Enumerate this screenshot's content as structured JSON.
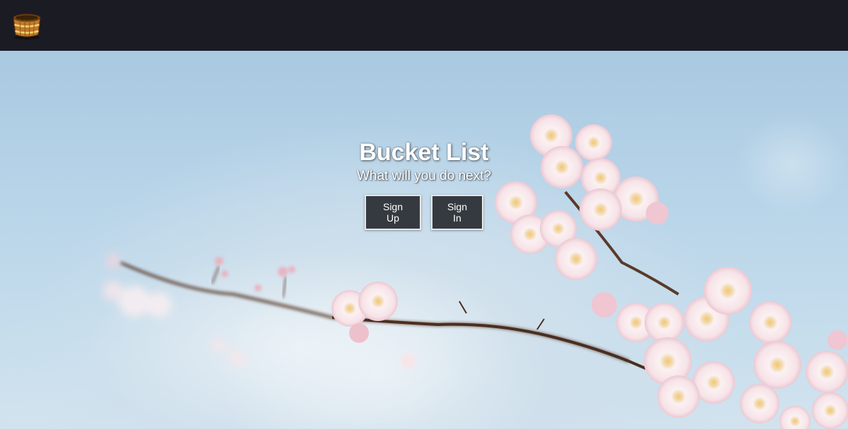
{
  "navbar": {
    "logo_icon": "bucket-icon",
    "background": "#1b1b24"
  },
  "hero": {
    "title": "Bucket List",
    "subtitle": "What will you do next?",
    "background_image": "cherry-blossom-branch-sky",
    "buttons": {
      "signup_label": "Sign Up",
      "signin_label": "Sign In",
      "button_color": "#343a40"
    }
  }
}
